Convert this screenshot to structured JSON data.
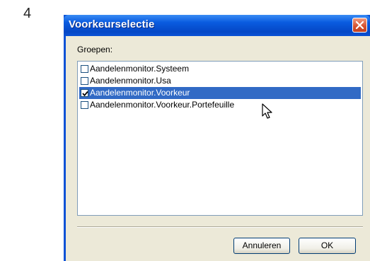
{
  "step_number": "4",
  "dialog": {
    "title": "Voorkeurselectie",
    "group_label": "Groepen:",
    "items": [
      {
        "label": "Aandelenmonitor.Systeem",
        "checked": false,
        "selected": false
      },
      {
        "label": "Aandelenmonitor.Usa",
        "checked": false,
        "selected": false
      },
      {
        "label": "Aandelenmonitor.Voorkeur",
        "checked": true,
        "selected": true
      },
      {
        "label": "Aandelenmonitor.Voorkeur.Portefeuille",
        "checked": false,
        "selected": false
      }
    ],
    "cancel_label": "Annuleren",
    "ok_label": "OK",
    "close_icon": "close-icon",
    "colors": {
      "title_bar": "#0a52d6",
      "selection": "#316ac5",
      "close_button": "#d4502e"
    }
  }
}
